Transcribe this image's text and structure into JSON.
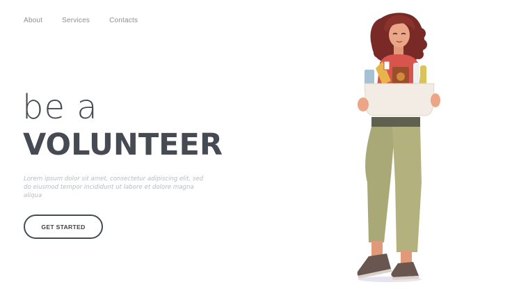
{
  "nav": {
    "items": [
      {
        "label": "About"
      },
      {
        "label": "Services"
      },
      {
        "label": "Contacts"
      }
    ]
  },
  "hero": {
    "line1": "be a",
    "line2": "VOLUNTEER",
    "body": "Lorem ipsum dolor sit amet, consectetur adipiscing elit, sed do eiusmod tempor incididunt ut labore et dolore magna aliqua",
    "cta_label": "GET STARTED"
  },
  "colors": {
    "text_dark": "#454a53",
    "nav_text": "#8a8e95",
    "muted_text": "#b8bbc0",
    "background": "#ffffff",
    "hair": "#7a2a26",
    "shirt": "#d8544c",
    "pants": "#a9a877",
    "box": "#f3ece4",
    "shoes": "#6a5650"
  },
  "illustration": {
    "subject": "volunteer-woman-holding-donation-box",
    "icons": [
      "woman-figure-icon",
      "donation-box-icon",
      "groceries-icon"
    ]
  }
}
